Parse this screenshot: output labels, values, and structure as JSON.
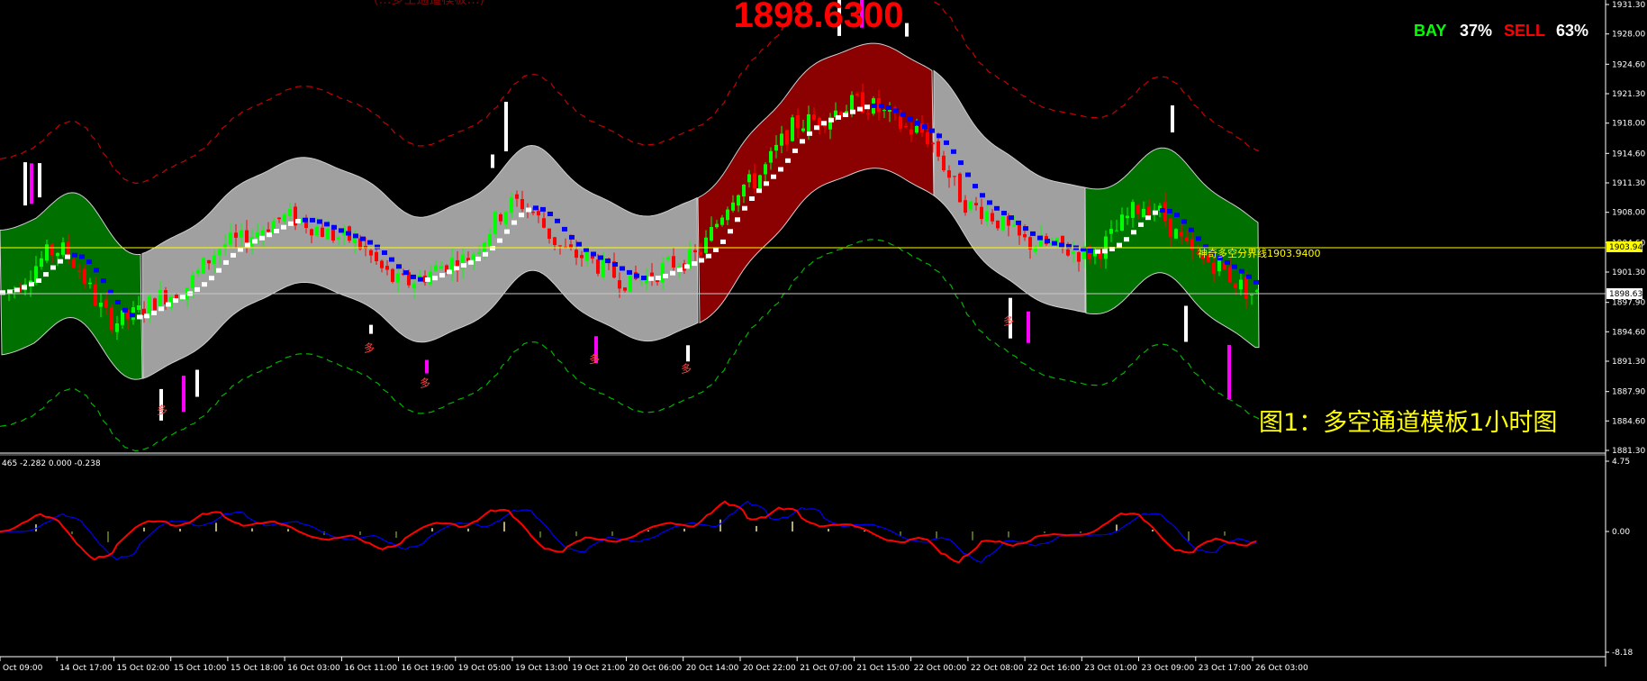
{
  "colors": {
    "background": "#000000",
    "bull_candle": "#00ff00",
    "bear_candle": "#ff0000",
    "neutral_band": "#a0a0a0",
    "bull_zone": "#007000",
    "bear_zone": "#8b0000",
    "ma_line_up": "#ffffff",
    "ma_line_down": "#0000ff",
    "upper_envelope": "#c80000",
    "lower_envelope": "#00b400",
    "macd_fast": "#ff0000",
    "macd_slow": "#0000ff",
    "divider_line": "#ffff00",
    "price_line": "#c8c8c8",
    "signal_buy": "#ffffff",
    "signal_sell": "#ff00ff",
    "title_red": "#ff0000",
    "caption_yellow": "#ffff00"
  },
  "overlay": {
    "big_price": "1898.6300",
    "top_fragment": "(…多空通道模板…)",
    "bay_label": "BAY",
    "bay_value": "37%",
    "sell_label": "SELL",
    "sell_value": "63%",
    "divider_label": "神奇多空分界线1903.9400",
    "caption": "图1：多空通道模板1小时图",
    "signal_glyph": "多"
  },
  "right_axis": {
    "main_ticks": [
      "1931.30",
      "1928.00",
      "1924.60",
      "1921.30",
      "1918.00",
      "1914.60",
      "1911.30",
      "1908.00",
      "1904.60",
      "1901.30",
      "1897.90",
      "1894.60",
      "1891.30",
      "1887.90",
      "1884.60",
      "1881.30"
    ],
    "divider_badge": "1903.94",
    "price_badge": "1898.63",
    "sub_ticks": [
      "4.75",
      "0.00",
      "-8.18"
    ]
  },
  "sub_window": {
    "header": "465 -2.282 0.000 -0.238"
  },
  "bottom_axis": {
    "labels": [
      "Oct 09:00",
      "14 Oct 17:00",
      "15 Oct 02:00",
      "15 Oct 10:00",
      "15 Oct 18:00",
      "16 Oct 03:00",
      "16 Oct 11:00",
      "16 Oct 19:00",
      "19 Oct 05:00",
      "19 Oct 13:00",
      "19 Oct 21:00",
      "20 Oct 06:00",
      "20 Oct 14:00",
      "20 Oct 22:00",
      "21 Oct 07:00",
      "21 Oct 15:00",
      "22 Oct 00:00",
      "22 Oct 08:00",
      "22 Oct 16:00",
      "23 Oct 01:00",
      "23 Oct 09:00",
      "23 Oct 17:00",
      "26 Oct 03:00"
    ]
  },
  "chart_data": {
    "type": "line",
    "title": "",
    "y_range": [
      1881.3,
      1931.3
    ],
    "x_labels": [
      "Oct 09:00",
      "14 Oct 17:00",
      "15 Oct 02:00",
      "15 Oct 10:00",
      "15 Oct 18:00",
      "16 Oct 03:00",
      "16 Oct 11:00",
      "16 Oct 19:00",
      "19 Oct 05:00",
      "19 Oct 13:00",
      "19 Oct 21:00",
      "20 Oct 06:00",
      "20 Oct 14:00",
      "20 Oct 22:00",
      "21 Oct 07:00",
      "21 Oct 15:00",
      "22 Oct 00:00",
      "22 Oct 08:00",
      "22 Oct 16:00",
      "23 Oct 01:00",
      "23 Oct 09:00",
      "23 Oct 17:00",
      "26 Oct 03:00"
    ],
    "series": [
      {
        "name": "",
        "values": [
          1899.0,
          1903.8,
          1895.8,
          1898.9,
          1904.6,
          1907.4,
          1905.1,
          1900.1,
          1902.6,
          1909.1,
          1903.2,
          1900.3,
          1902.7,
          1911.1,
          1918.1,
          1920.2,
          1917.1,
          1908.5,
          1904.5,
          1903.4,
          1908.8,
          1902.6,
          1898.6
        ]
      }
    ],
    "divider_level": 1903.94,
    "last_price": 1898.63,
    "grid": false
  }
}
